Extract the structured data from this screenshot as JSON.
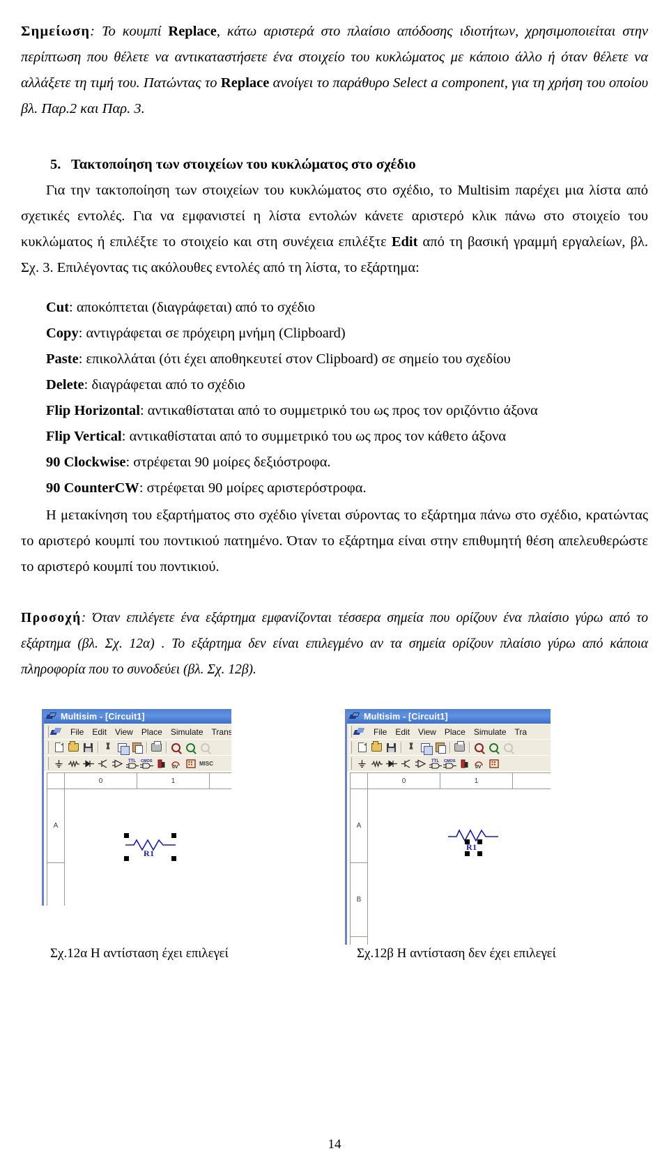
{
  "note": {
    "lead": "Σημείωση",
    "colon": ": ",
    "seg1": "Το κουμπί ",
    "bold1": "Replace",
    "seg2": ", κάτω αριστερά στο πλαίσιο απόδοσης ιδιοτήτων, χρησιμοποιείται στην περίπτωση που θέλετε να αντικαταστήσετε ένα στοιχείο του κυκλώματος με κάποιο άλλο ή όταν θέλετε να αλλάξετε τη τιμή του. Πατώντας το ",
    "bold2": "Replace",
    "seg3": "  ανοίγει το παράθυρο Select a component, για τη χρήση του οποίου βλ. Παρ.2 και Παρ. 3."
  },
  "section": {
    "number": "5.",
    "title": "Τακτοποίηση των στοιχείων του κυκλώματος στο σχέδιο",
    "para_seg1": "Για την τακτοποίηση των στοιχείων του κυκλώματος στο σχέδιο, το Multisim παρέχει μια λίστα από σχετικές εντολές. Για να εμφανιστεί η λίστα εντολών κάνετε αριστερό κλικ πάνω στο στοιχείο του κυκλώματος ή επιλέξτε το στοιχείο και στη συνέχεια επιλέξτε ",
    "para_bold": "Edit",
    "para_seg2": " από τη βασική γραμμή εργαλείων, βλ. Σχ. 3. Επιλέγοντας τις ακόλουθες εντολές από τη λίστα, το εξάρτημα:"
  },
  "commands": [
    {
      "name": "Cut",
      "desc": ": αποκόπτεται (διαγράφεται) από το σχέδιο"
    },
    {
      "name": "Copy",
      "desc": ": αντιγράφεται σε πρόχειρη μνήμη (Clipboard)"
    },
    {
      "name": "Paste",
      "desc": ": επικολλάται (ότι έχει αποθηκευτεί στον Clipboard) σε σημείο του σχεδίου"
    },
    {
      "name": "Delete",
      "desc": ": διαγράφεται από το σχέδιο"
    },
    {
      "name": "Flip Horizontal",
      "desc": ":  αντικαθίσταται από το συμμετρικό του ως προς τον οριζόντιο άξονα"
    },
    {
      "name": "Flip Vertical",
      "desc": ": αντικαθίσταται από το συμμετρικό του ως προς τον κάθετο άξονα"
    },
    {
      "name": "90 Clockwise",
      "desc": ": στρέφεται 90 μοίρες δεξιόστροφα."
    },
    {
      "name": "90 CounterCW",
      "desc": ": στρέφεται 90 μοίρες αριστερόστροφα."
    }
  ],
  "move_paragraph": "Η μετακίνηση του εξαρτήματος στο σχέδιο γίνεται σύροντας το εξάρτημα πάνω στο σχέδιο, κρατώντας το αριστερό κουμπί του ποντικιού πατημένο. Όταν το εξάρτημα είναι στην επιθυμητή θέση απελευθερώστε το αριστερό κουμπί του ποντικιού.",
  "attention": {
    "lead": "Προσοχή",
    "text": ": Όταν επιλέγετε ένα εξάρτημα εμφανίζονται τέσσερα σημεία που ορίζουν ένα  πλαίσιο γύρω από το εξάρτημα (βλ. Σχ. 12α) . Το εξάρτημα  δεν είναι επιλεγμένο αν τα σημεία ορίζουν πλαίσιο γύρω από κάποια πληροφορία που το συνοδεύει (βλ. Σχ. 12β)."
  },
  "figures": {
    "window": {
      "title": "Multisim - [Circuit1]",
      "menus": [
        "File",
        "Edit",
        "View",
        "Place",
        "Simulate",
        "Transfer"
      ],
      "menus_clipped_left": "Transf",
      "menus_clipped_right": "Tra",
      "toolbar_icons": [
        "new-file-icon",
        "open-folder-icon",
        "save-disk-icon",
        "cut-scissors-icon",
        "copy-icon",
        "paste-icon",
        "print-icon",
        "zoom-in-icon",
        "zoom-out-icon",
        "zoom-disabled-icon"
      ],
      "component_icons": [
        "ground-source-icon",
        "resistor-basic-icon",
        "diode-icon",
        "transistor-icon",
        "opamp-icon",
        "ttl-gate-icon",
        "cmos-gate-icon",
        "misc-digital-icon",
        "mixed-icon",
        "indicator-icon",
        "misc-icon"
      ],
      "misc_label": "MISC",
      "ruler_columns": [
        "0",
        "1"
      ],
      "ruler_rows_left": [
        "A"
      ],
      "ruler_rows_right": [
        "A",
        "B"
      ]
    },
    "component": {
      "ref": "R1",
      "handle_count": 4
    },
    "captions": {
      "a": "Σχ.12α  Η αντίσταση έχει επιλεγεί",
      "b": "Σχ.12β Η αντίσταση δεν έχει επιλεγεί"
    }
  },
  "folio": "14",
  "colors": {
    "titlebar": "#4f7fd4",
    "chrome": "#efebdf",
    "component": "#1a1aa8",
    "handle": "#000000",
    "window_edge": "#6a83c8"
  }
}
